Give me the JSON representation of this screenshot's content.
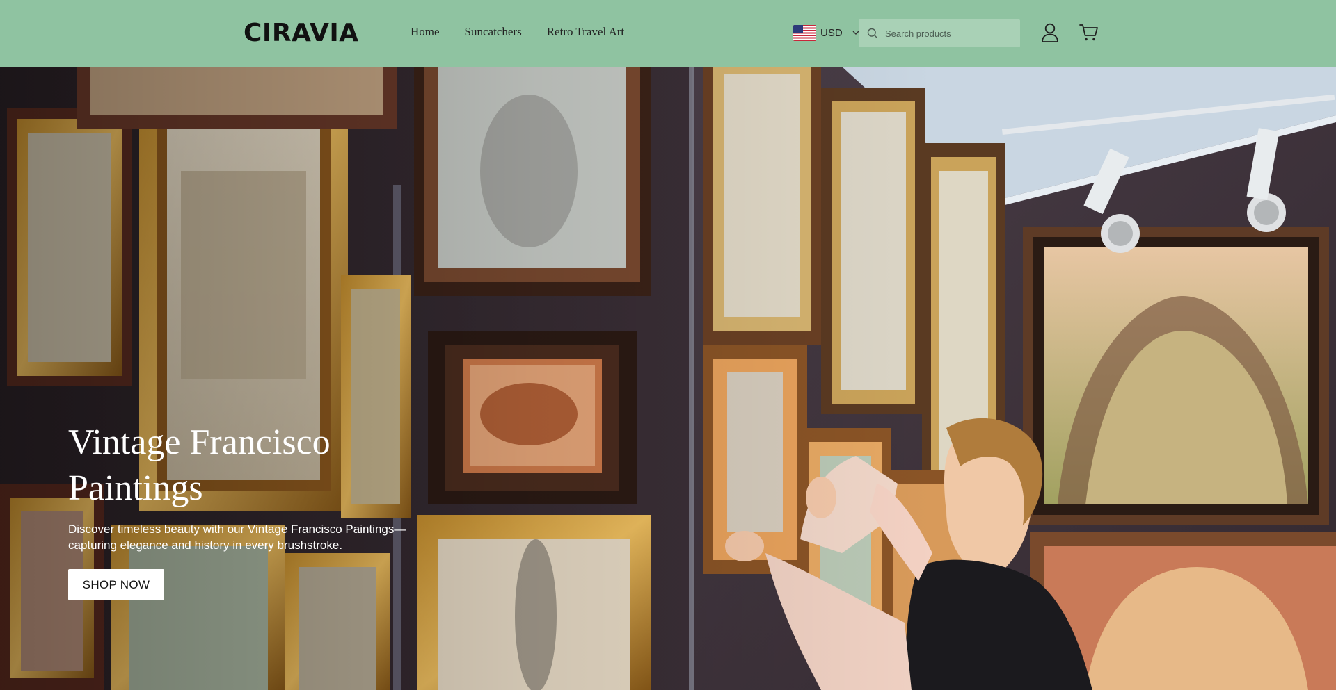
{
  "header": {
    "logo": "CIRAVIA",
    "nav": [
      "Home",
      "Suncatchers",
      "Retro Travel Art"
    ],
    "currency": "USD",
    "search_placeholder": "Search products",
    "icons": {
      "account": "account-icon",
      "cart": "cart-icon",
      "search": "search-icon",
      "flag": "us-flag-icon"
    },
    "background_color": "#8fc3a1"
  },
  "hero": {
    "title_line1": "Vintage Francisco",
    "title_line2": "Paintings",
    "description_line1": "Discover timeless beauty with our Vintage Francisco Paintings—",
    "description_line2": "capturing elegance and history in every brushstroke.",
    "button": "SHOP NOW",
    "image": "Gallery wall of framed vintage paintings with a woman adjusting a frame"
  }
}
